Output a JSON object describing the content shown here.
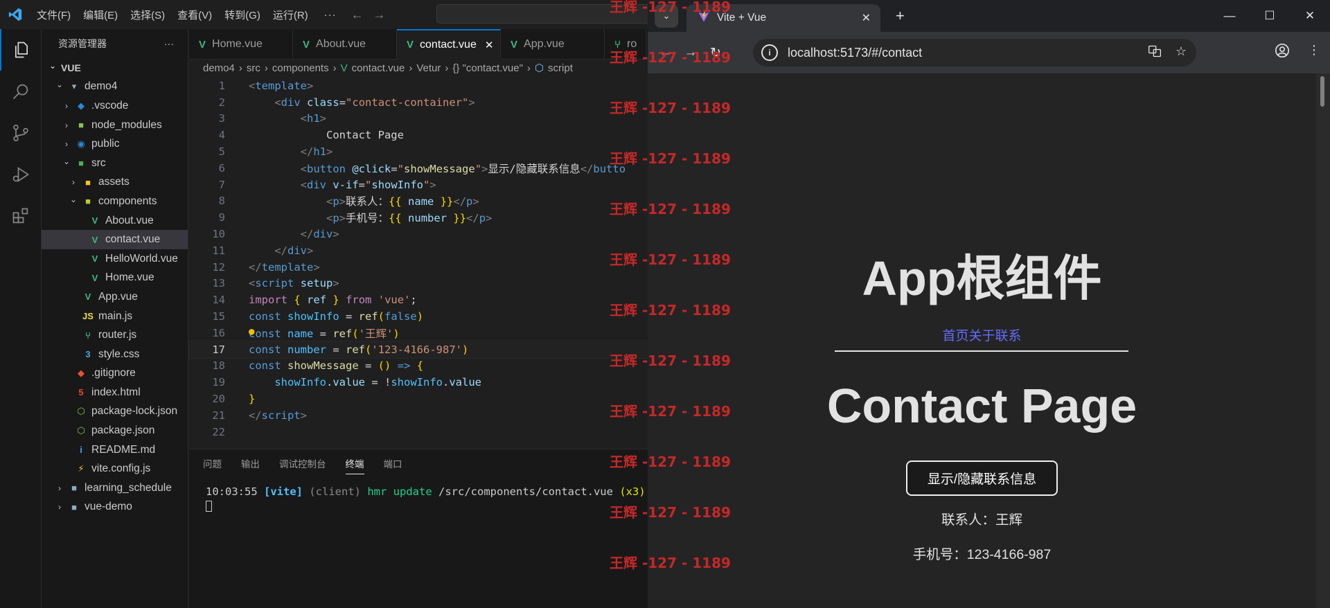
{
  "vscode": {
    "menu": [
      "文件(F)",
      "编辑(E)",
      "选择(S)",
      "查看(V)",
      "转到(G)",
      "运行(R)"
    ],
    "menu_more": "···",
    "sidebar_title": "资源管理器",
    "sidebar_more": "···",
    "tree": [
      {
        "label": "VUE",
        "depth": 0,
        "chev": "⌄",
        "icon": "",
        "bold": true
      },
      {
        "label": "demo4",
        "depth": 1,
        "chev": "⌄",
        "icon": "folder-open"
      },
      {
        "label": ".vscode",
        "depth": 2,
        "chev": "›",
        "icon": "folder-vscode"
      },
      {
        "label": "node_modules",
        "depth": 2,
        "chev": "›",
        "icon": "folder-node"
      },
      {
        "label": "public",
        "depth": 2,
        "chev": "›",
        "icon": "folder-public"
      },
      {
        "label": "src",
        "depth": 2,
        "chev": "⌄",
        "icon": "folder-src"
      },
      {
        "label": "assets",
        "depth": 3,
        "chev": "›",
        "icon": "folder-assets"
      },
      {
        "label": "components",
        "depth": 3,
        "chev": "⌄",
        "icon": "folder-components"
      },
      {
        "label": "About.vue",
        "depth": 4,
        "chev": "",
        "icon": "vue"
      },
      {
        "label": "contact.vue",
        "depth": 4,
        "chev": "",
        "icon": "vue",
        "selected": true
      },
      {
        "label": "HelloWorld.vue",
        "depth": 4,
        "chev": "",
        "icon": "vue"
      },
      {
        "label": "Home.vue",
        "depth": 4,
        "chev": "",
        "icon": "vue"
      },
      {
        "label": "App.vue",
        "depth": 3,
        "chev": "",
        "icon": "vue"
      },
      {
        "label": "main.js",
        "depth": 3,
        "chev": "",
        "icon": "js"
      },
      {
        "label": "router.js",
        "depth": 3,
        "chev": "",
        "icon": "router"
      },
      {
        "label": "style.css",
        "depth": 3,
        "chev": "",
        "icon": "css"
      },
      {
        "label": ".gitignore",
        "depth": 2,
        "chev": "",
        "icon": "git"
      },
      {
        "label": "index.html",
        "depth": 2,
        "chev": "",
        "icon": "html"
      },
      {
        "label": "package-lock.json",
        "depth": 2,
        "chev": "",
        "icon": "node"
      },
      {
        "label": "package.json",
        "depth": 2,
        "chev": "",
        "icon": "node"
      },
      {
        "label": "README.md",
        "depth": 2,
        "chev": "",
        "icon": "info"
      },
      {
        "label": "vite.config.js",
        "depth": 2,
        "chev": "",
        "icon": "vite"
      },
      {
        "label": "learning_schedule",
        "depth": 1,
        "chev": "›",
        "icon": "folder"
      },
      {
        "label": "vue-demo",
        "depth": 1,
        "chev": "›",
        "icon": "folder"
      }
    ],
    "tabs": [
      {
        "label": "Home.vue",
        "active": false
      },
      {
        "label": "About.vue",
        "active": false
      },
      {
        "label": "contact.vue",
        "active": true
      },
      {
        "label": "App.vue",
        "active": false
      },
      {
        "label": "ro",
        "active": false
      }
    ],
    "tab_close": "✕",
    "breadcrumb": [
      "demo4",
      "src",
      "components",
      "contact.vue",
      "Vetur",
      "{} \"contact.vue\"",
      "script"
    ],
    "code_lines": [
      [
        [
          "t-br",
          "<"
        ],
        [
          "t-tag",
          "template"
        ],
        [
          "t-br",
          ">"
        ]
      ],
      [
        [
          "t-txt",
          "    "
        ],
        [
          "t-br",
          "<"
        ],
        [
          "t-tag",
          "div"
        ],
        [
          "t-txt",
          " "
        ],
        [
          "t-attr",
          "class"
        ],
        [
          "t-txt",
          "="
        ],
        [
          "t-str",
          "\"contact-container\""
        ],
        [
          "t-br",
          ">"
        ]
      ],
      [
        [
          "t-txt",
          "        "
        ],
        [
          "t-br",
          "<"
        ],
        [
          "t-tag",
          "h1"
        ],
        [
          "t-br",
          ">"
        ]
      ],
      [
        [
          "t-txt",
          "            Contact Page"
        ]
      ],
      [
        [
          "t-txt",
          "        "
        ],
        [
          "t-br",
          "</"
        ],
        [
          "t-tag",
          "h1"
        ],
        [
          "t-br",
          ">"
        ]
      ],
      [
        [
          "t-txt",
          "        "
        ],
        [
          "t-br",
          "<"
        ],
        [
          "t-tag",
          "button"
        ],
        [
          "t-txt",
          " "
        ],
        [
          "t-attr",
          "@click"
        ],
        [
          "t-txt",
          "="
        ],
        [
          "t-str",
          "\""
        ],
        [
          "t-fn",
          "showMessage"
        ],
        [
          "t-str",
          "\""
        ],
        [
          "t-br",
          ">"
        ],
        [
          "t-txt",
          "显示/隐藏联系信息"
        ],
        [
          "t-br",
          "</"
        ],
        [
          "t-tag",
          "butto"
        ]
      ],
      [
        [
          "t-txt",
          "        "
        ],
        [
          "t-br",
          "<"
        ],
        [
          "t-tag",
          "div"
        ],
        [
          "t-txt",
          " "
        ],
        [
          "t-attr",
          "v-if"
        ],
        [
          "t-txt",
          "="
        ],
        [
          "t-str",
          "\""
        ],
        [
          "t-prop",
          "showInfo"
        ],
        [
          "t-str",
          "\""
        ],
        [
          "t-br",
          ">"
        ]
      ],
      [
        [
          "t-txt",
          "            "
        ],
        [
          "t-br",
          "<"
        ],
        [
          "t-tag",
          "p"
        ],
        [
          "t-br",
          ">"
        ],
        [
          "t-txt",
          "联系人："
        ],
        [
          "t-br1",
          "{{ "
        ],
        [
          "t-prop",
          "name"
        ],
        [
          "t-br1",
          " }}"
        ],
        [
          "t-br",
          "</"
        ],
        [
          "t-tag",
          "p"
        ],
        [
          "t-br",
          ">"
        ]
      ],
      [
        [
          "t-txt",
          "            "
        ],
        [
          "t-br",
          "<"
        ],
        [
          "t-tag",
          "p"
        ],
        [
          "t-br",
          ">"
        ],
        [
          "t-txt",
          "手机号："
        ],
        [
          "t-br1",
          "{{ "
        ],
        [
          "t-prop",
          "number"
        ],
        [
          "t-br1",
          " }}"
        ],
        [
          "t-br",
          "</"
        ],
        [
          "t-tag",
          "p"
        ],
        [
          "t-br",
          ">"
        ]
      ],
      [
        [
          "t-txt",
          "        "
        ],
        [
          "t-br",
          "</"
        ],
        [
          "t-tag",
          "div"
        ],
        [
          "t-br",
          ">"
        ]
      ],
      [
        [
          "t-txt",
          "    "
        ],
        [
          "t-br",
          "</"
        ],
        [
          "t-tag",
          "div"
        ],
        [
          "t-br",
          ">"
        ]
      ],
      [
        [
          "t-br",
          "</"
        ],
        [
          "t-tag",
          "template"
        ],
        [
          "t-br",
          ">"
        ]
      ],
      [
        [
          "t-br",
          "<"
        ],
        [
          "t-tag",
          "script"
        ],
        [
          "t-txt",
          " "
        ],
        [
          "t-attr",
          "setup"
        ],
        [
          "t-br",
          ">"
        ]
      ],
      [
        [
          "t-imp",
          "import"
        ],
        [
          "t-txt",
          " "
        ],
        [
          "t-br1",
          "{"
        ],
        [
          "t-txt",
          " "
        ],
        [
          "t-prop",
          "ref"
        ],
        [
          "t-txt",
          " "
        ],
        [
          "t-br1",
          "}"
        ],
        [
          "t-txt",
          " "
        ],
        [
          "t-imp",
          "from"
        ],
        [
          "t-txt",
          " "
        ],
        [
          "t-str",
          "'vue'"
        ],
        [
          "t-txt",
          ";"
        ]
      ],
      [
        [
          "t-kw",
          "const"
        ],
        [
          "t-txt",
          " "
        ],
        [
          "t-var",
          "showInfo"
        ],
        [
          "t-txt",
          " = "
        ],
        [
          "t-fn",
          "ref"
        ],
        [
          "t-br1",
          "("
        ],
        [
          "t-kw",
          "false"
        ],
        [
          "t-br1",
          ")"
        ]
      ],
      [
        [
          "t-kw",
          "const"
        ],
        [
          "t-txt",
          " "
        ],
        [
          "t-var",
          "name"
        ],
        [
          "t-txt",
          " = "
        ],
        [
          "t-fn",
          "ref"
        ],
        [
          "t-br1",
          "("
        ],
        [
          "t-str",
          "'王辉'"
        ],
        [
          "t-br1",
          ")"
        ]
      ],
      [
        [
          "t-kw",
          "const"
        ],
        [
          "t-txt",
          " "
        ],
        [
          "t-var",
          "number"
        ],
        [
          "t-txt",
          " = "
        ],
        [
          "t-fn",
          "ref"
        ],
        [
          "t-br1",
          "("
        ],
        [
          "t-str",
          "'123-4166-987'"
        ],
        [
          "t-br1",
          ")"
        ]
      ],
      [
        [
          "t-kw",
          "const"
        ],
        [
          "t-txt",
          " "
        ],
        [
          "t-fn",
          "showMessage"
        ],
        [
          "t-txt",
          " = "
        ],
        [
          "t-br1",
          "()"
        ],
        [
          "t-txt",
          " "
        ],
        [
          "t-kw",
          "=>"
        ],
        [
          "t-txt",
          " "
        ],
        [
          "t-br1",
          "{"
        ]
      ],
      [
        [
          "t-txt",
          "    "
        ],
        [
          "t-var",
          "showInfo"
        ],
        [
          "t-txt",
          "."
        ],
        [
          "t-prop",
          "value"
        ],
        [
          "t-txt",
          " = !"
        ],
        [
          "t-var",
          "showInfo"
        ],
        [
          "t-txt",
          "."
        ],
        [
          "t-prop",
          "value"
        ]
      ],
      [
        [
          "t-br1",
          "}"
        ]
      ],
      [
        [
          "t-br",
          "</"
        ],
        [
          "t-tag",
          "script"
        ],
        [
          "t-br",
          ">"
        ]
      ],
      []
    ],
    "current_line": 17,
    "panel_tabs": [
      "问题",
      "输出",
      "调试控制台",
      "终端",
      "端口"
    ],
    "panel_active": "终端",
    "terminal": {
      "time": "10:03:55",
      "tag": "[vite]",
      "client": "(client)",
      "hmr": "hmr update",
      "path": "/src/components/contact.vue",
      "count": "(x3)"
    }
  },
  "watermark": "王辉 -127 - 1189",
  "chrome": {
    "tab_title": "Vite + Vue",
    "tab_close": "✕",
    "new_tab": "+",
    "url": "localhost:5173/#/contact",
    "win_min": "—",
    "win_max": "☐",
    "win_close": "✕"
  },
  "page": {
    "app_title": "App根组件",
    "nav_links": [
      "首页",
      "关于",
      "联系"
    ],
    "contact_title": "Contact Page",
    "toggle_button": "显示/隐藏联系信息",
    "contact_person": "联系人：王辉",
    "phone": "手机号：123-4166-987"
  },
  "colors": {
    "accent": "#0078d4",
    "vue_green": "#41b883",
    "link": "#646cff",
    "watermark": "#c62828"
  }
}
